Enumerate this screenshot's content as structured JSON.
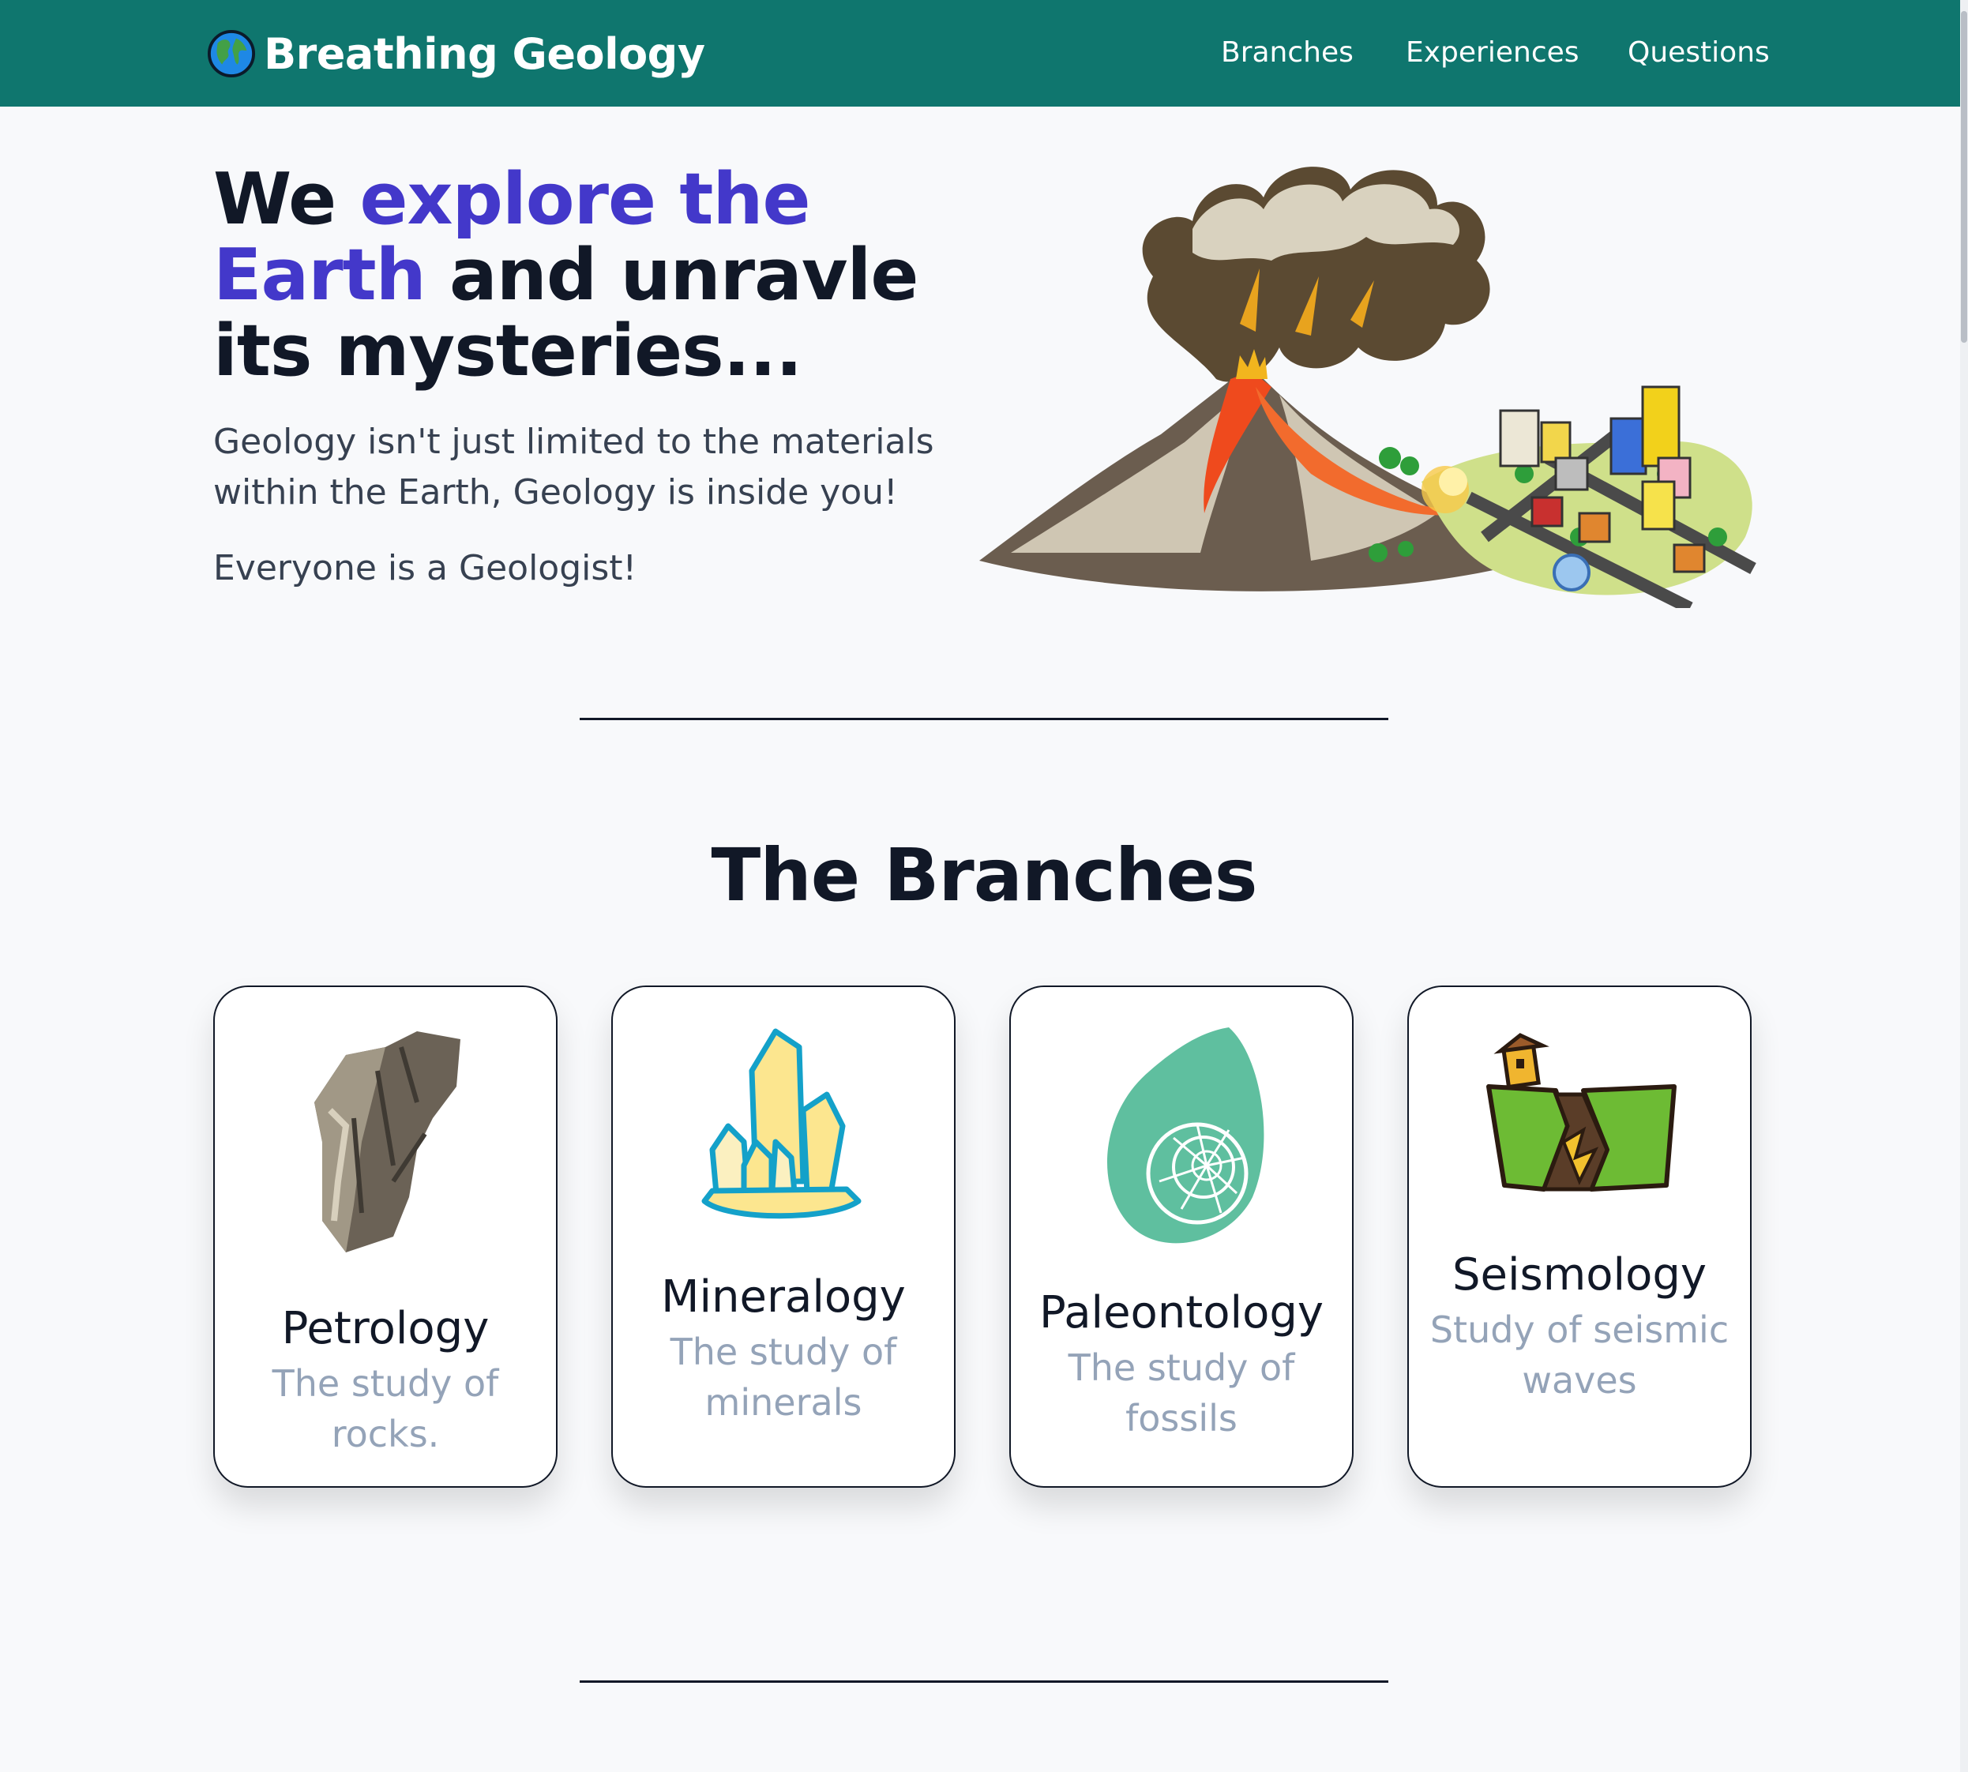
{
  "nav": {
    "brand": "Breathing Geology",
    "links": [
      "Branches",
      "Experiences",
      "Questions"
    ],
    "bg_color": "#0f766e"
  },
  "hero": {
    "title_1": "We ",
    "title_accent_1": "explore the",
    "title_accent_2": "Earth",
    "title_2": " and unravle its mysteries...",
    "paragraph_1": "Geology isn't just limited to the materials within the Earth, Geology is inside you!",
    "paragraph_2": "Everyone is a Geologist!",
    "accent_color": "#4338ca"
  },
  "branches": {
    "title": "The Branches",
    "cards": [
      {
        "name": "Petrology",
        "desc": "The study of rocks.",
        "icon": "rock-icon"
      },
      {
        "name": "Mineralogy",
        "desc": "The study of minerals",
        "icon": "crystal-icon"
      },
      {
        "name": "Paleontology",
        "desc": "The study of fossils",
        "icon": "ammonite-fossil-icon"
      },
      {
        "name": "Seismology",
        "desc": "Study of seismic waves",
        "icon": "earthquake-icon"
      }
    ]
  }
}
